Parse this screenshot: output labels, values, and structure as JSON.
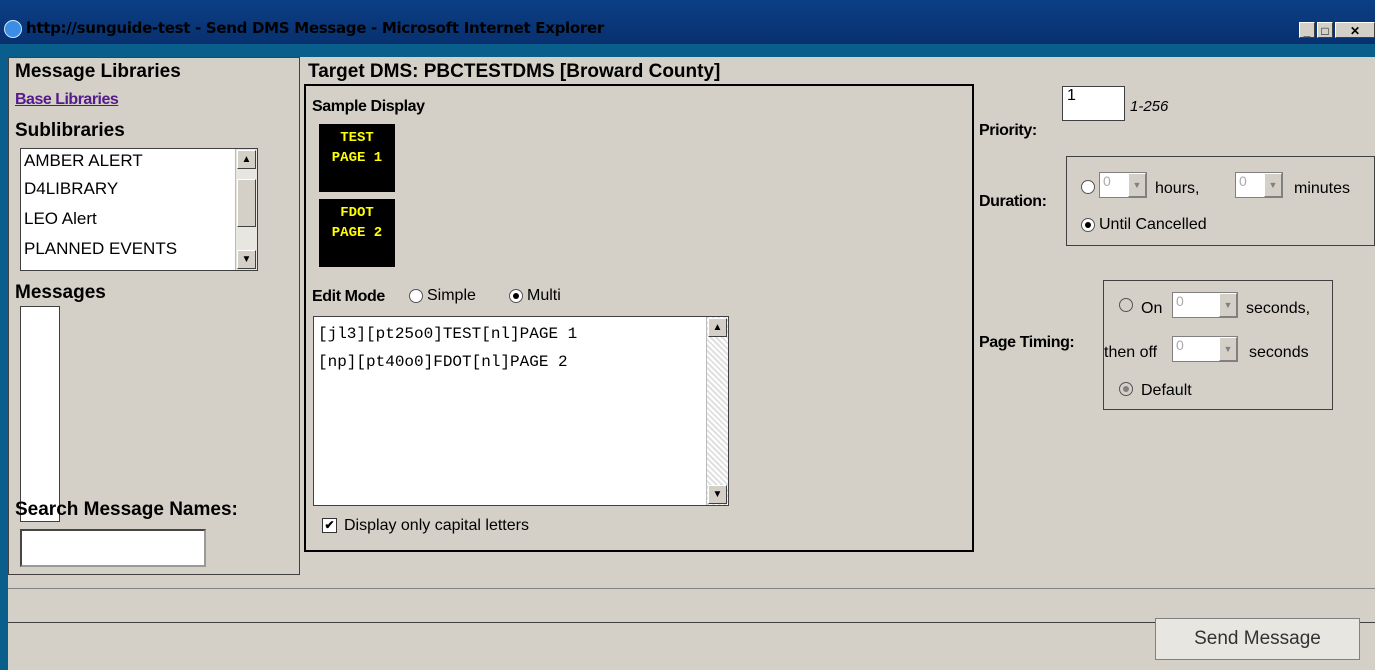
{
  "window": {
    "title": "http://sunguide-test - Send DMS Message - Microsoft Internet Explorer",
    "min": "_",
    "max": "□",
    "close": "✕"
  },
  "left": {
    "libraries_title": "Message Libraries",
    "base_libraries_link": "Base Libraries",
    "sublibraries_title": "Sublibraries",
    "sublibraries": [
      "AMBER ALERT",
      "D4LIBRARY",
      "LEO Alert",
      "PLANNED EVENTS"
    ],
    "messages_title": "Messages",
    "search_title": "Search Message Names:",
    "search_value": ""
  },
  "center": {
    "target_title": "Target DMS: PBCTESTDMS [Broward County]",
    "sample_title": "Sample Display",
    "page1": [
      "TEST",
      "PAGE 1"
    ],
    "page2": [
      "FDOT",
      "PAGE 2"
    ],
    "edit_mode_label": "Edit Mode",
    "edit_modes": {
      "simple": "Simple",
      "multi": "Multi",
      "selected": "multi"
    },
    "editor_lines": [
      "[jl3][pt25o0]TEST[nl]PAGE 1",
      "[np][pt40o0]FDOT[nl]PAGE 2"
    ],
    "caps_label": "Display only capital letters",
    "caps_checked": true
  },
  "right": {
    "priority_label": "Priority:",
    "priority_value": "1",
    "priority_range": "1-256",
    "duration_label": "Duration:",
    "hours_value": "0",
    "hours_label": "hours,",
    "minutes_value": "0",
    "minutes_label": "minutes",
    "until_cancelled": "Until Cancelled",
    "timing_label": "Page Timing:",
    "on_label": "On",
    "on_value": "0",
    "seconds1": "seconds,",
    "then_off": "then off",
    "off_value": "0",
    "seconds2": "seconds",
    "default_label": "Default"
  },
  "footer": {
    "send_label": "Send Message"
  }
}
